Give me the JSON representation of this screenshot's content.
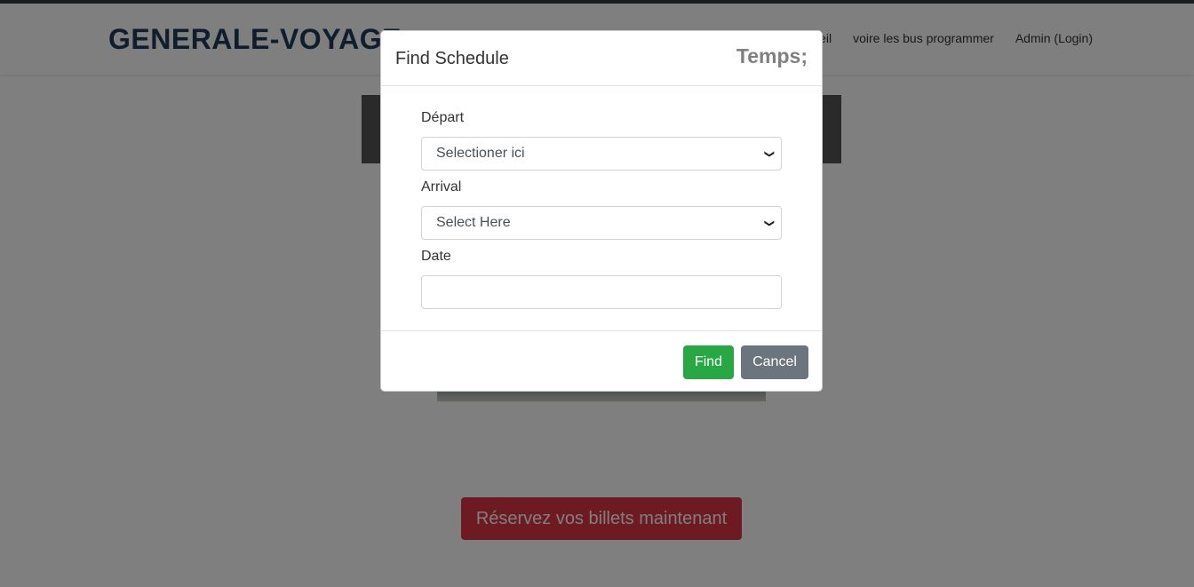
{
  "navbar": {
    "brand": "GENERALE-VOYAGE",
    "links": [
      "Accueil",
      "voire les bus programmer",
      "Admin (Login)"
    ]
  },
  "hero": {
    "reserve_button": "Réservez vos billets maintenant"
  },
  "modal": {
    "title": "Find Schedule",
    "clock": "Temps;",
    "fields": {
      "departure_label": "Départ",
      "departure_value": "Selectioner ici",
      "arrival_label": "Arrival",
      "arrival_value": "Select Here",
      "date_label": "Date",
      "date_value": ""
    },
    "find_button": "Find",
    "cancel_button": "Cancel"
  },
  "colors": {
    "brand": "#1f3a5a",
    "find": "#28a745",
    "cancel": "#6c757d",
    "reserve": "#dc3545"
  }
}
